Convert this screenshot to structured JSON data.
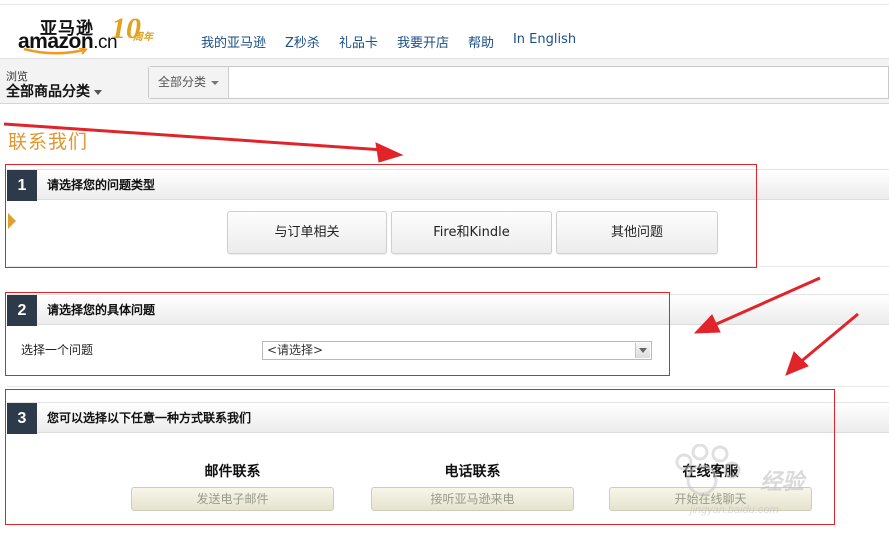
{
  "header": {
    "logo_cn": "亚马逊",
    "logo_en": "amazon",
    "logo_tld": ".cn",
    "anniversary_num": "10",
    "anniversary_label": "周年",
    "nav": [
      "我的亚马逊",
      "Z秒杀",
      "礼品卡",
      "我要开店",
      "帮助",
      "In English"
    ]
  },
  "navbar": {
    "browse_small": "浏览",
    "browse_big": "全部商品分类",
    "search_category": "全部分类",
    "search_placeholder": ""
  },
  "page_title": "联系我们",
  "step1": {
    "num": "1",
    "title": "请选择您的问题类型",
    "options": [
      "与订单相关",
      "Fire和Kindle",
      "其他问题"
    ]
  },
  "step2": {
    "num": "2",
    "title": "请选择您的具体问题",
    "label": "选择一个问题",
    "select_value": "<请选择>"
  },
  "step3": {
    "num": "3",
    "title": "您可以选择以下任意一种方式联系我们",
    "methods": [
      {
        "title": "邮件联系",
        "button": "发送电子邮件"
      },
      {
        "title": "电话联系",
        "button": "接听亚马逊来电"
      },
      {
        "title": "在线客服",
        "button": "开始在线聊天"
      }
    ]
  },
  "watermark": {
    "text": "经验",
    "sub": "jingyan.baidu.com"
  },
  "colors": {
    "accent_orange": "#e09730",
    "link_blue": "#1a4f8a",
    "step_badge": "#2d3a4a",
    "annotation_red": "#e0242a"
  }
}
